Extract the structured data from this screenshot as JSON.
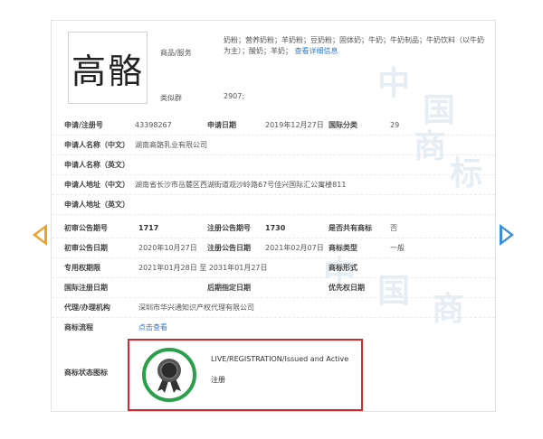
{
  "trademark": {
    "logo_text": "高骼",
    "goods_label": "商品/服务",
    "goods_text": "奶粉；营养奶粉；羊奶粉；豆奶粉；固体奶；牛奶；牛奶制品；牛奶饮料（以牛奶为主）；酸奶；羊奶；",
    "goods_more": "查看详细信息",
    "class_label": "类似群",
    "class_value": "2907;"
  },
  "fields": {
    "app_no_label": "申请/注册号",
    "app_no": "43398267",
    "app_date_label": "申请日期",
    "app_date": "2019年12月27日",
    "intl_class_label": "国际分类",
    "intl_class": "29",
    "applicant_cn_label": "申请人名称（中文）",
    "applicant_cn": "湖南高骼乳业有限公司",
    "applicant_en_label": "申请人名称（英文）",
    "address_cn_label": "申请人地址（中文）",
    "address_cn": "湖南省长沙市岳麓区西湖街道观沙岭路67号佳兴国际汇公寓楼811",
    "address_en_label": "申请人地址（英文）",
    "prelim_no_label": "初审公告期号",
    "prelim_no": "1717",
    "reg_pub_no_label": "注册公告期号",
    "reg_pub_no": "1730",
    "shared_label": "是否共有商标",
    "shared": "否",
    "prelim_date_label": "初审公告日期",
    "prelim_date": "2020年10月27日",
    "reg_pub_date_label": "注册公告日期",
    "reg_pub_date": "2021年02月07日",
    "tm_type_label": "商标类型",
    "tm_type": "一般",
    "exclusive_label": "专用权期限",
    "exclusive": "2021年01月28日 至 2031年01月27日",
    "tm_form_label": "商标形式",
    "intl_reg_date_label": "国际注册日期",
    "later_date_label": "后期指定日期",
    "priority_date_label": "优先权日期",
    "agent_label": "代理/办理机构",
    "agent": "深圳市华兴通知识产权代理有限公司",
    "process_label": "商标流程",
    "process_link": "点击查看",
    "status_label": "商标状态图标",
    "status_en": "LIVE/REGISTRATION/Issued and Active",
    "status_cn": "注册"
  },
  "watermark": [
    "中",
    "国",
    "商",
    "标"
  ],
  "colors": {
    "accent_link": "#2a7ad6",
    "status_ring": "#2aa04a",
    "highlight_box": "#d22a2a",
    "arrow_left": "#f0a020",
    "arrow_right": "#3a8fd6"
  }
}
